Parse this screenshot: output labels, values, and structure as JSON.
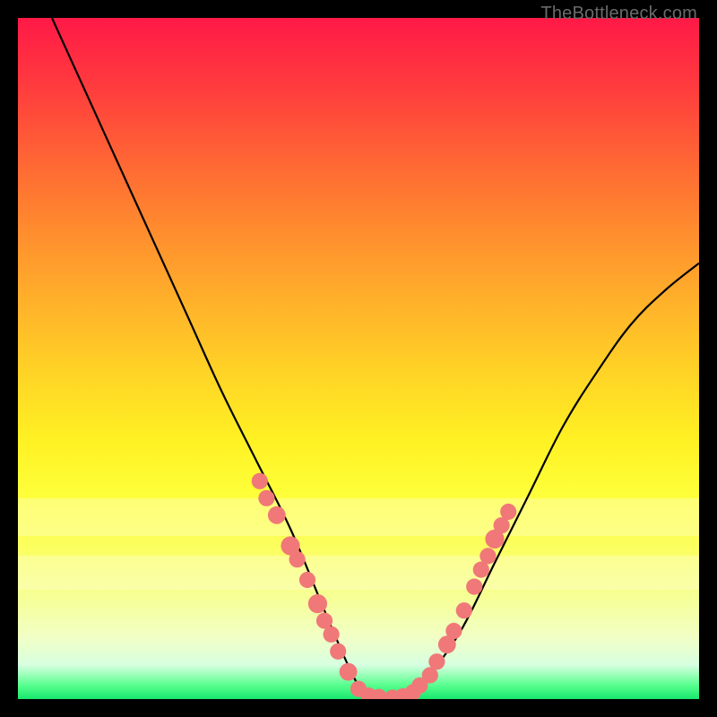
{
  "watermark": "TheBottleneck.com",
  "chart_data": {
    "type": "line",
    "title": "",
    "xlabel": "",
    "ylabel": "",
    "xlim": [
      0,
      100
    ],
    "ylim": [
      0,
      100
    ],
    "grid": false,
    "legend": false,
    "series": [
      {
        "name": "curve",
        "x": [
          5,
          10,
          15,
          20,
          25,
          30,
          35,
          40,
          45,
          48,
          50,
          52,
          55,
          58,
          60,
          65,
          70,
          75,
          80,
          85,
          90,
          95,
          100
        ],
        "values": [
          100,
          89,
          78,
          67,
          56,
          45,
          35,
          25,
          13,
          6,
          2,
          0,
          0,
          1,
          3,
          10,
          20,
          30,
          40,
          48,
          55,
          60,
          64
        ]
      }
    ],
    "markers": [
      {
        "x": 35.5,
        "y": 32.0,
        "r": 1.2
      },
      {
        "x": 36.5,
        "y": 29.5,
        "r": 1.2
      },
      {
        "x": 38.0,
        "y": 27.0,
        "r": 1.3
      },
      {
        "x": 40.0,
        "y": 22.5,
        "r": 1.4
      },
      {
        "x": 41.0,
        "y": 20.5,
        "r": 1.2
      },
      {
        "x": 42.5,
        "y": 17.5,
        "r": 1.2
      },
      {
        "x": 44.0,
        "y": 14.0,
        "r": 1.4
      },
      {
        "x": 45.0,
        "y": 11.5,
        "r": 1.2
      },
      {
        "x": 46.0,
        "y": 9.5,
        "r": 1.2
      },
      {
        "x": 47.0,
        "y": 7.0,
        "r": 1.2
      },
      {
        "x": 48.5,
        "y": 4.0,
        "r": 1.3
      },
      {
        "x": 50.0,
        "y": 1.5,
        "r": 1.2
      },
      {
        "x": 51.5,
        "y": 0.5,
        "r": 1.2
      },
      {
        "x": 53.0,
        "y": 0.3,
        "r": 1.2
      },
      {
        "x": 55.0,
        "y": 0.2,
        "r": 1.2
      },
      {
        "x": 56.5,
        "y": 0.4,
        "r": 1.2
      },
      {
        "x": 58.0,
        "y": 1.0,
        "r": 1.2
      },
      {
        "x": 59.0,
        "y": 2.0,
        "r": 1.2
      },
      {
        "x": 60.5,
        "y": 3.5,
        "r": 1.2
      },
      {
        "x": 61.5,
        "y": 5.5,
        "r": 1.2
      },
      {
        "x": 63.0,
        "y": 8.0,
        "r": 1.3
      },
      {
        "x": 64.0,
        "y": 10.0,
        "r": 1.2
      },
      {
        "x": 65.5,
        "y": 13.0,
        "r": 1.2
      },
      {
        "x": 67.0,
        "y": 16.5,
        "r": 1.2
      },
      {
        "x": 68.0,
        "y": 19.0,
        "r": 1.2
      },
      {
        "x": 69.0,
        "y": 21.0,
        "r": 1.2
      },
      {
        "x": 70.0,
        "y": 23.5,
        "r": 1.4
      },
      {
        "x": 71.0,
        "y": 25.5,
        "r": 1.2
      },
      {
        "x": 72.0,
        "y": 27.5,
        "r": 1.2
      }
    ],
    "marker_color": "#f07878",
    "curve_color": "#000000"
  }
}
